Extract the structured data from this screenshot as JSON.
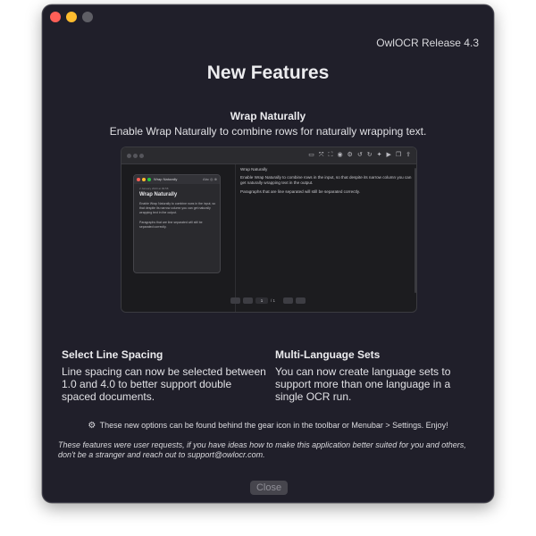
{
  "window": {
    "release_label": "OwlOCR Release 4.3",
    "heading": "New Features"
  },
  "feature_main": {
    "title": "Wrap Naturally",
    "description": "Enable Wrap Naturally to combine rows for naturally wrapping text."
  },
  "preview": {
    "inner_window_title": "Wrap Naturally",
    "inner_window_controls": "Abc ◎ ⊕",
    "inner_meta": "2 January 2023 at 09:58",
    "inner_heading": "Wrap Naturally",
    "inner_paragraph_1": "Enable Wrap Naturally to combine rows in the input, so that despite its narrow column you can get naturally wrapping text in the output.",
    "inner_paragraph_2": "Paragraphs that are line separated will still be separated correctly.",
    "output_title": "Wrap Naturally",
    "output_paragraph_1": "Enable Wrap Naturally to combine rows in the input, so that despite its narrow column you can get naturally wrapping text in the output.",
    "output_paragraph_2": "Paragraphs that are line separated will still be separated correctly.",
    "page_current": "1",
    "page_total": "/ 1",
    "toolbar_icons": [
      "▭",
      "⤧",
      "⛶",
      "◉",
      "⚙",
      "↺",
      "↻",
      "✦",
      "▶",
      "❐",
      "⇪"
    ]
  },
  "feature_left": {
    "title": "Select Line Spacing",
    "description": "Line spacing can now be selected between 1.0 and 4.0 to better support double spaced documents."
  },
  "feature_right": {
    "title": "Multi-Language Sets",
    "description": "You can now create language sets to support more than one language in a single OCR run."
  },
  "hint": {
    "icon": "gear-icon",
    "glyph": "⚙",
    "text": "These new options can be found behind the gear icon in the toolbar or Menubar > Settings. Enjoy!"
  },
  "note": "These features were user requests, if you have ideas how to make this application better suited for you and others, don't be a stranger and reach out to support@owlocr.com.",
  "close_label": "Close",
  "colors": {
    "window_bg": "#201f2a",
    "close_dot": "#ff5f57",
    "minimize_dot": "#febc2e",
    "zoom_dot": "#5e5e65"
  }
}
